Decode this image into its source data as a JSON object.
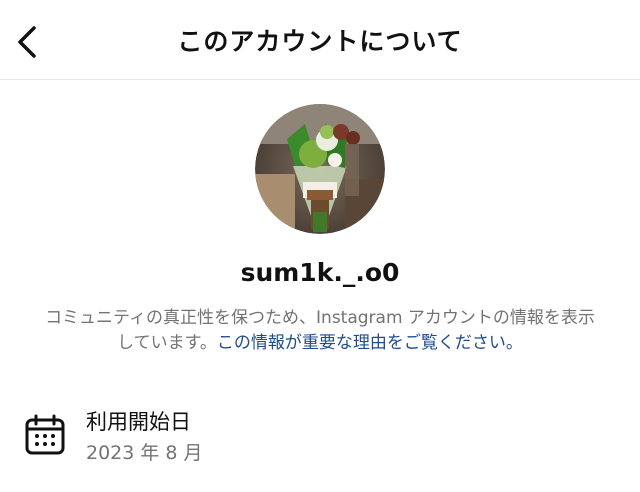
{
  "header": {
    "title": "このアカウントについて",
    "back_icon": "chevron-left-icon"
  },
  "profile": {
    "avatar_icon": "avatar",
    "username": "sum1k._.o0"
  },
  "description": {
    "text": "コミュニティの真正性を保つため、Instagram アカウントの情報を表示しています。",
    "link": "この情報が重要な理由をご覧ください。"
  },
  "account_info": {
    "icon": "calendar-icon",
    "label": "利用開始日",
    "value": "2023 年 8 月"
  },
  "colors": {
    "link": "#1f4c8f",
    "secondary_text": "#737373",
    "divider": "#e6e6e6"
  }
}
